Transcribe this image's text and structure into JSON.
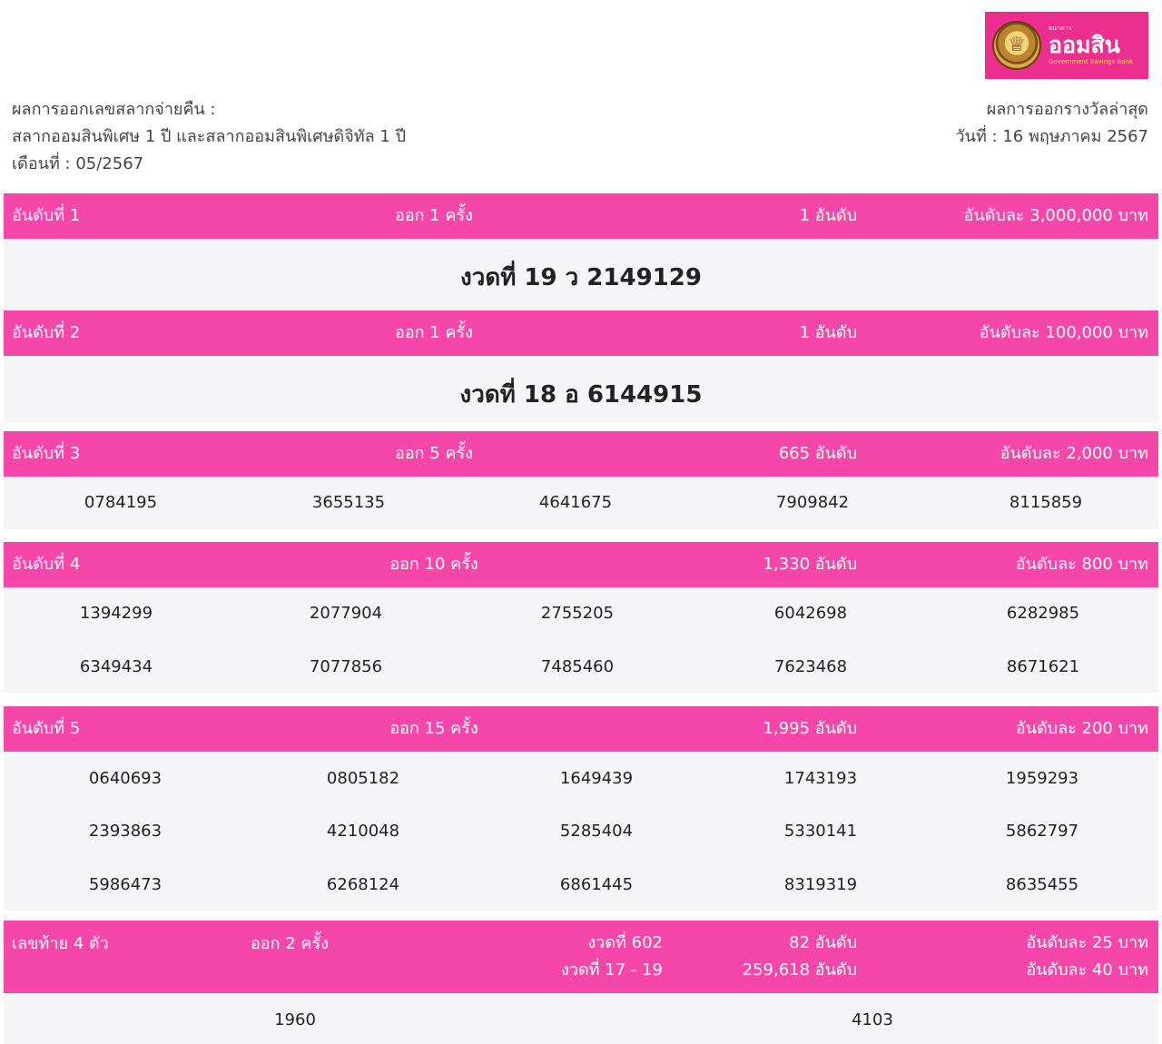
{
  "logo": {
    "small": "ธนาคาร",
    "name": "ออมสิน",
    "sub": "Government Savings Bank"
  },
  "header": {
    "left": [
      "ผลการออกเลขสลากจ่ายคืน :",
      "สลากออมสินพิเศษ 1 ปี และสลากออมสินพิเศษดิจิทัล 1 ปี",
      "เดือนที่ : 05/2567"
    ],
    "right": [
      "ผลการออกรางวัลล่าสุด",
      "วันที่ : 16 พฤษภาคม 2567"
    ]
  },
  "prizes": [
    {
      "rank": "อันดับที่ 1",
      "draws": "ออก 1 ครั้ง",
      "count": "1 อันดับ",
      "amount": "อันดับละ 3,000,000 บาท",
      "big": "งวดที่ 19 ว 2149129"
    },
    {
      "rank": "อันดับที่ 2",
      "draws": "ออก 1 ครั้ง",
      "count": "1 อันดับ",
      "amount": "อันดับละ 100,000 บาท",
      "big": "งวดที่ 18 อ 6144915"
    },
    {
      "rank": "อันดับที่ 3",
      "draws": "ออก 5 ครั้ง",
      "count": "665 อันดับ",
      "amount": "อันดับละ 2,000 บาท",
      "numbers": [
        "0784195",
        "3655135",
        "4641675",
        "7909842",
        "8115859"
      ]
    },
    {
      "rank": "อันดับที่ 4",
      "draws": "ออก 10 ครั้ง",
      "count": "1,330 อันดับ",
      "amount": "อันดับละ 800 บาท",
      "numbers": [
        "1394299",
        "2077904",
        "2755205",
        "6042698",
        "6282985",
        "6349434",
        "7077856",
        "7485460",
        "7623468",
        "8671621"
      ]
    },
    {
      "rank": "อันดับที่ 5",
      "draws": "ออก 15 ครั้ง",
      "count": "1,995 อันดับ",
      "amount": "อันดับละ 200 บาท",
      "numbers": [
        "0640693",
        "0805182",
        "1649439",
        "1743193",
        "1959293",
        "2393863",
        "4210048",
        "5285404",
        "5330141",
        "5862797",
        "5986473",
        "6268124",
        "6861445",
        "8319319",
        "8635455"
      ]
    }
  ],
  "last4": {
    "label": "เลขท้าย 4 ตัว",
    "draws": "ออก 2 ครั้ง",
    "periods": [
      "งวดที่ 602",
      "งวดที่ 17 - 19"
    ],
    "counts": [
      "82 อันดับ",
      "259,618 อันดับ"
    ],
    "amounts": [
      "อันดับละ 25 บาท",
      "อันดับละ 40 บาท"
    ],
    "numbers": [
      "1960",
      "4103"
    ]
  }
}
